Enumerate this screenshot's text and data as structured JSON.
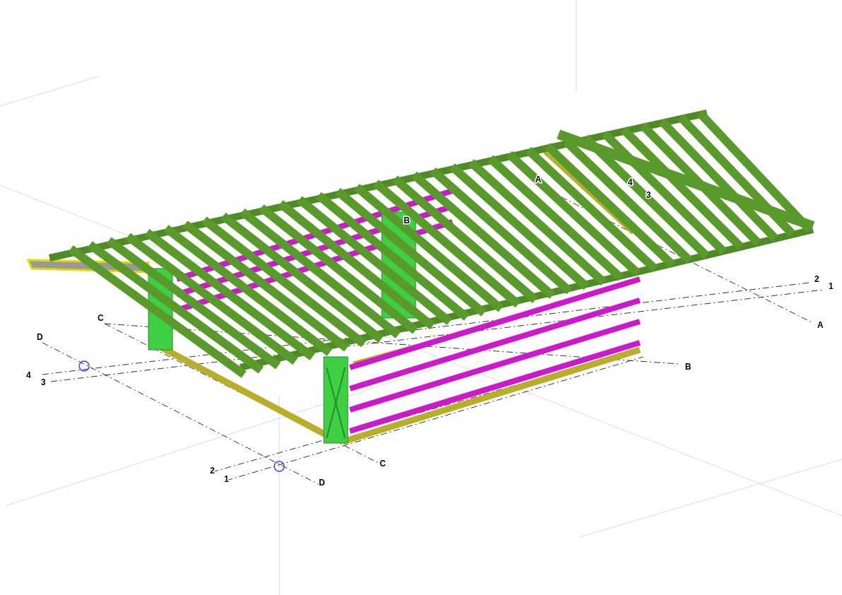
{
  "viewport": {
    "grid_labels": [
      {
        "text": "A"
      },
      {
        "text": "4"
      },
      {
        "text": "3"
      },
      {
        "text": "B"
      },
      {
        "text": "2"
      },
      {
        "text": "1"
      },
      {
        "text": "C"
      },
      {
        "text": "A"
      },
      {
        "text": "D"
      },
      {
        "text": "B"
      },
      {
        "text": "4"
      },
      {
        "text": "3"
      },
      {
        "text": "C"
      },
      {
        "text": "2"
      },
      {
        "text": "1"
      },
      {
        "text": "D"
      }
    ]
  }
}
